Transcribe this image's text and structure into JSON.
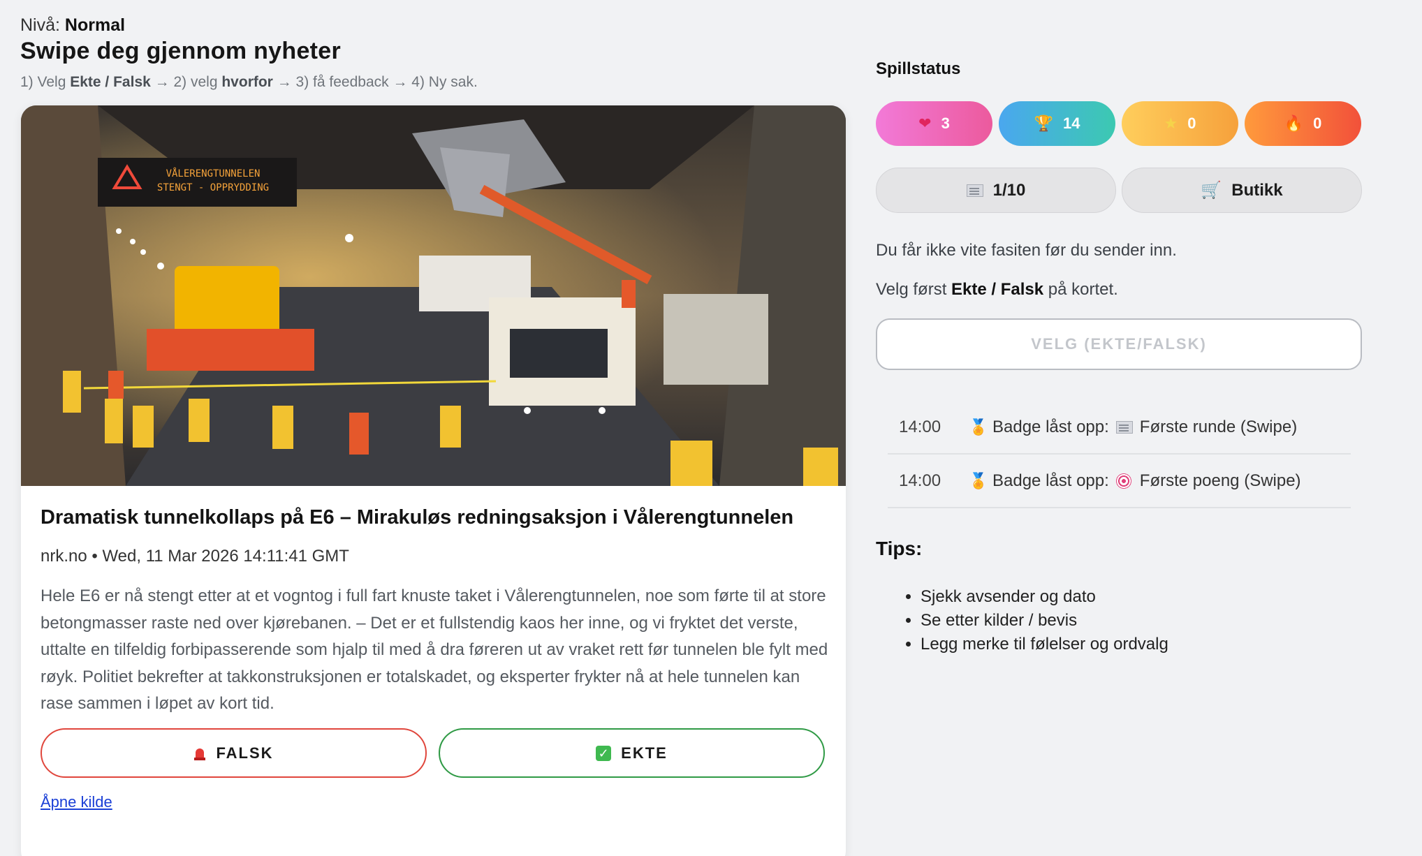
{
  "header": {
    "level_label": "Nivå:",
    "level_value": "Normal",
    "title": "Swipe deg gjennom nyheter",
    "steps": {
      "s1": "1) Velg",
      "s1b": "Ekte / Falsk",
      "s2": "→ 2) velg",
      "s2b": "hvorfor",
      "s3": "→ 3) få feedback → 4) Ny sak."
    }
  },
  "article": {
    "image_sign": {
      "line1": "VÅLERENGTUNNELEN",
      "line2": "STENGT - OPPRYDDING"
    },
    "headline": "Dramatisk tunnelkollaps på E6 – Mirakuløs redningsaksjon i Vålerengtunnelen",
    "meta": "nrk.no • Wed, 11 Mar 2026 14:11:41 GMT",
    "body": "Hele E6 er nå stengt etter at et vogntog i full fart knuste taket i Vålerengtunnelen, noe som førte til at store betongmasser raste ned over kjørebanen. – Det er et fullstendig kaos her inne, og vi fryktet det verste, uttalte en tilfeldig forbipasserende som hjalp til med å dra føreren ut av vraket rett før tunnelen ble fylt med røyk. Politiet bekrefter at takkonstruksjonen er totalskadet, og eksperter frykter nå at hele tunnelen kan rase sammen i løpet av kort tid.",
    "falsk_label": "FALSK",
    "ekte_label": "EKTE",
    "source_link": "Åpne kilde"
  },
  "status": {
    "heading": "Spillstatus",
    "hearts": "3",
    "trophies": "14",
    "stars": "0",
    "streak": "0",
    "progress": "1/10",
    "shop_label": "Butikk",
    "colors": {
      "hearts": "#ec5a9d",
      "trophies": "#3cc9b1",
      "stars": "#f6a13c",
      "streak": "#f2513a"
    }
  },
  "info": {
    "line1": "Du får ikke vite fasiten før du sender inn.",
    "line2a": "Velg først",
    "line2b": "Ekte / Falsk",
    "line2c": "på kortet.",
    "submit_label": "VELG (EKTE/FALSK)"
  },
  "log": [
    {
      "time": "14:00",
      "text": "Badge låst opp:",
      "badge": "Første runde (Swipe)",
      "icon": "newspaper-icon"
    },
    {
      "time": "14:00",
      "text": "Badge låst opp:",
      "badge": "Første poeng (Swipe)",
      "icon": "target-icon"
    }
  ],
  "tips": {
    "heading": "Tips:",
    "items": [
      "Sjekk avsender og dato",
      "Se etter kilder / bevis",
      "Legg merke til følelser og ordvalg"
    ]
  }
}
